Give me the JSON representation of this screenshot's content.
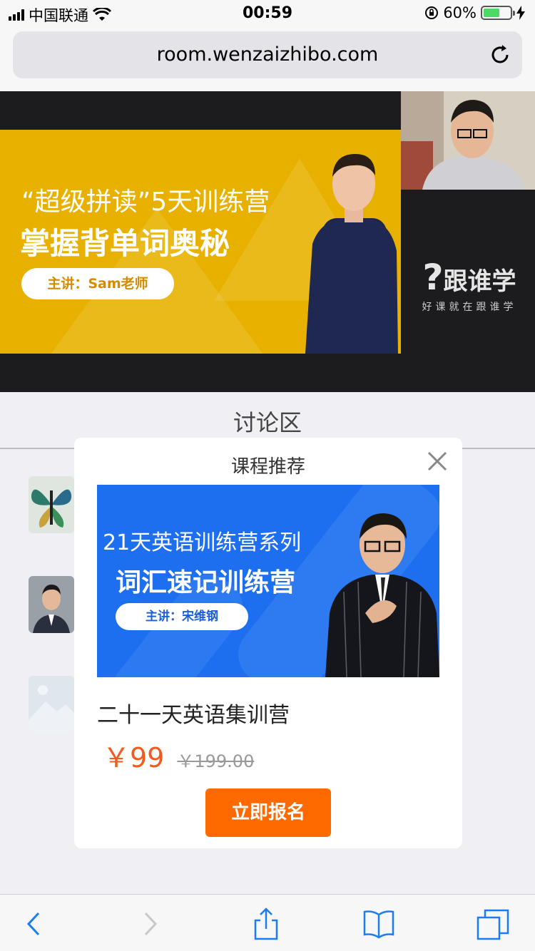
{
  "status": {
    "carrier": "中国联通",
    "time": "00:59",
    "battery": "60%",
    "battery_level": 0.6
  },
  "browser": {
    "url": "room.wenzaizhibo.com"
  },
  "video": {
    "banner_line1": "“超级拼读”5天训练营",
    "banner_line2": "掌握背单词奥秘",
    "banner_pill": "主讲：Sam老师",
    "brand_name": "跟谁学",
    "brand_slogan": "好课就在跟谁学"
  },
  "discussion": {
    "tab_label": "讨论区"
  },
  "card": {
    "title": "课程推荐",
    "banner_line1": "21天英语训练营系列",
    "banner_line2": "词汇速记训练营",
    "banner_pill": "主讲：宋维钢",
    "course_name": "二十一天英语集训营",
    "price_now": "￥99",
    "price_old": "￥199.00",
    "enroll_label": "立即报名"
  },
  "colors": {
    "banner_yellow": "#e8b100",
    "card_blue": "#1d6ff0",
    "accent_orange": "#ff6a00",
    "price_red": "#f25a1e",
    "ios_blue": "#1a7df2"
  }
}
